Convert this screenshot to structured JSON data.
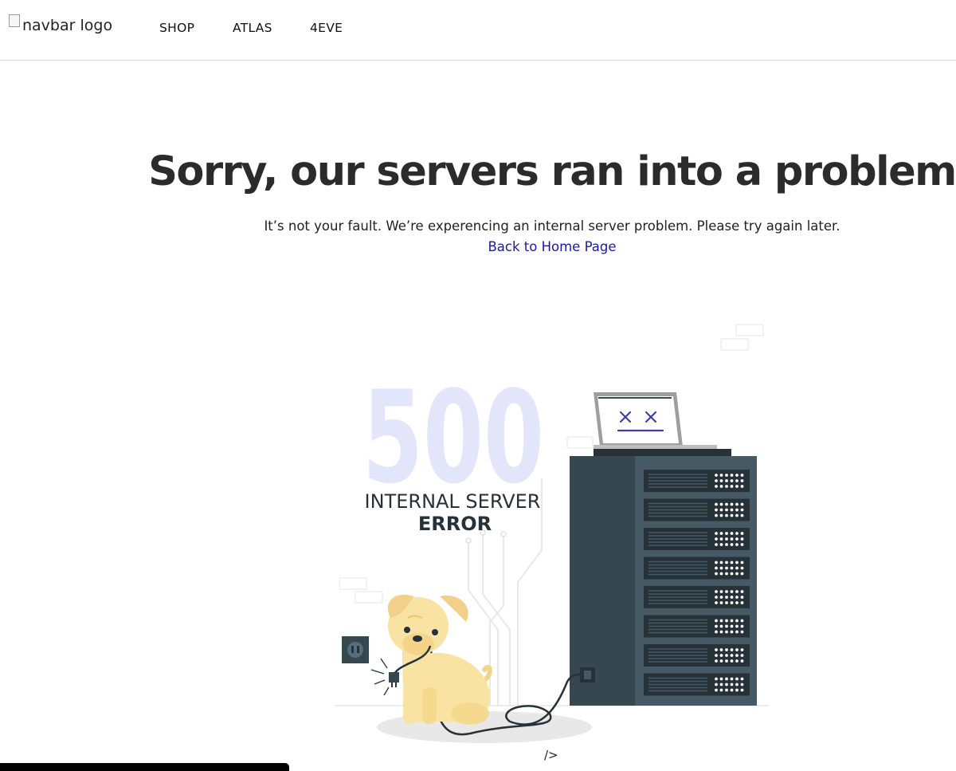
{
  "navbar": {
    "logo_alt": "navbar logo",
    "links": [
      "SHOP",
      "ATLAS",
      "4EVE"
    ]
  },
  "error": {
    "title": "Sorry, our servers ran into a problem",
    "message": "It’s not your fault. We’re experencing an internal server problem. Please try again later.",
    "home_link": "Back to Home Page"
  },
  "illustration": {
    "code": "500",
    "line1": "INTERNAL SERVER",
    "line2": "ERROR",
    "icons": [
      "server-rack-icon",
      "laptop-icon",
      "dog-icon",
      "power-outlet-icon",
      "plug-icon"
    ]
  },
  "footer": {
    "code_tag": "/>"
  },
  "colors": {
    "server_dark": "#37474f",
    "server_mid": "#455a64",
    "code_light": "#e3e5fb",
    "dog": "#f9e3a3",
    "link": "#1a1aa6"
  }
}
